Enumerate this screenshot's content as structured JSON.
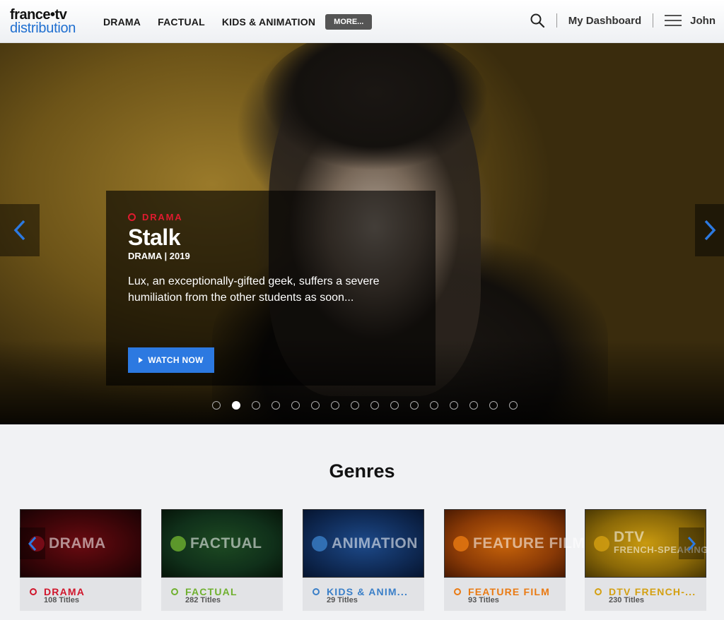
{
  "header": {
    "logo_line1": "france•tv",
    "logo_line2": "distribution",
    "nav": [
      "DRAMA",
      "FACTUAL",
      "KIDS & ANIMATION"
    ],
    "more_label": "MORE...",
    "dashboard_label": "My Dashboard",
    "user_name": "John"
  },
  "hero": {
    "genre_label": "DRAMA",
    "title": "Stalk",
    "meta": "DRAMA | 2019",
    "description": "Lux, an exceptionally-gifted geek, suffers a severe humiliation from the other students as soon...",
    "watch_label": "WATCH NOW",
    "slide_count": 16,
    "active_slide": 2,
    "accent_color": "#e01b2f",
    "button_color": "#2c79e1"
  },
  "genres": {
    "title": "Genres",
    "items": [
      {
        "image_text": "DRAMA",
        "name": "DRAMA",
        "count": "108 Titles",
        "color": "#d0152b"
      },
      {
        "image_text": "FACTUAL",
        "name": "FACTUAL",
        "count": "282 Titles",
        "color": "#6fb02f"
      },
      {
        "image_text": "ANIMATION",
        "name": "KIDS & ANIM...",
        "count": "29 Titles",
        "color": "#3a7fc8"
      },
      {
        "image_text": "FEATURE FILM",
        "name": "FEATURE FILM",
        "count": "93 Titles",
        "color": "#ea7a12"
      },
      {
        "image_text": "DTV",
        "image_subtext": "FRENCH-SPEAKING",
        "name": "DTV FRENCH-...",
        "count": "230 Titles",
        "color": "#d4a012"
      }
    ]
  }
}
